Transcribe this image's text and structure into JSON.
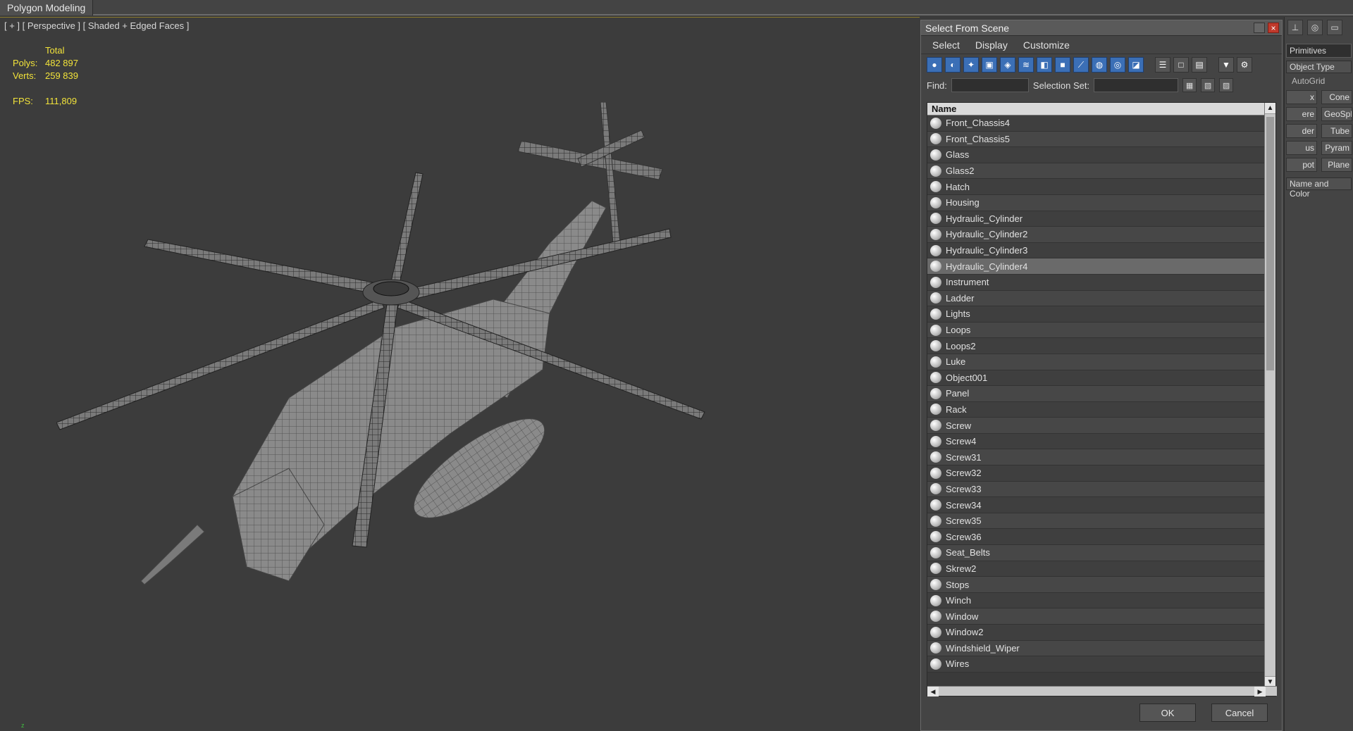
{
  "ribbon": {
    "tab_label": "Polygon Modeling"
  },
  "viewport": {
    "label": "[ + ] [ Perspective ] [ Shaded + Edged Faces ]",
    "stats": {
      "header": "Total",
      "polys_label": "Polys:",
      "polys_value": "482 897",
      "verts_label": "Verts:",
      "verts_value": "259 839",
      "fps_label": "FPS:",
      "fps_value": "111,809"
    }
  },
  "dialog": {
    "title": "Select From Scene",
    "close_glyph": "×",
    "menu": [
      "Select",
      "Display",
      "Customize"
    ],
    "find_label": "Find:",
    "find_value": "",
    "selection_set_label": "Selection Set:",
    "selection_set_value": "",
    "column_header": "Name",
    "selected_item": "Hydraulic_Cylinder4",
    "items": [
      "Front_Chassis4",
      "Front_Chassis5",
      "Glass",
      "Glass2",
      "Hatch",
      "Housing",
      "Hydraulic_Cylinder",
      "Hydraulic_Cylinder2",
      "Hydraulic_Cylinder3",
      "Hydraulic_Cylinder4",
      "Instrument",
      "Ladder",
      "Lights",
      "Loops",
      "Loops2",
      "Luke",
      "Object001",
      "Panel",
      "Rack",
      "Screw",
      "Screw4",
      "Screw31",
      "Screw32",
      "Screw33",
      "Screw34",
      "Screw35",
      "Screw36",
      "Seat_Belts",
      "Skrew2",
      "Stops",
      "Winch",
      "Window",
      "Window2",
      "Windshield_Wiper",
      "Wires"
    ],
    "ok_label": "OK",
    "cancel_label": "Cancel"
  },
  "command_panel": {
    "dropdown": "Primitives",
    "rollout_object_type": "Object Type",
    "autogrid": "AutoGrid",
    "buttons": [
      "x",
      "Cone",
      "ere",
      "GeoSph",
      "der",
      "Tube",
      "us",
      "Pyram",
      "pot",
      "Plane"
    ],
    "rollout_name_color": "Name and Color"
  },
  "colors": {
    "stats_text": "#f2e33a",
    "selection_blue": "#3b6fb6"
  }
}
